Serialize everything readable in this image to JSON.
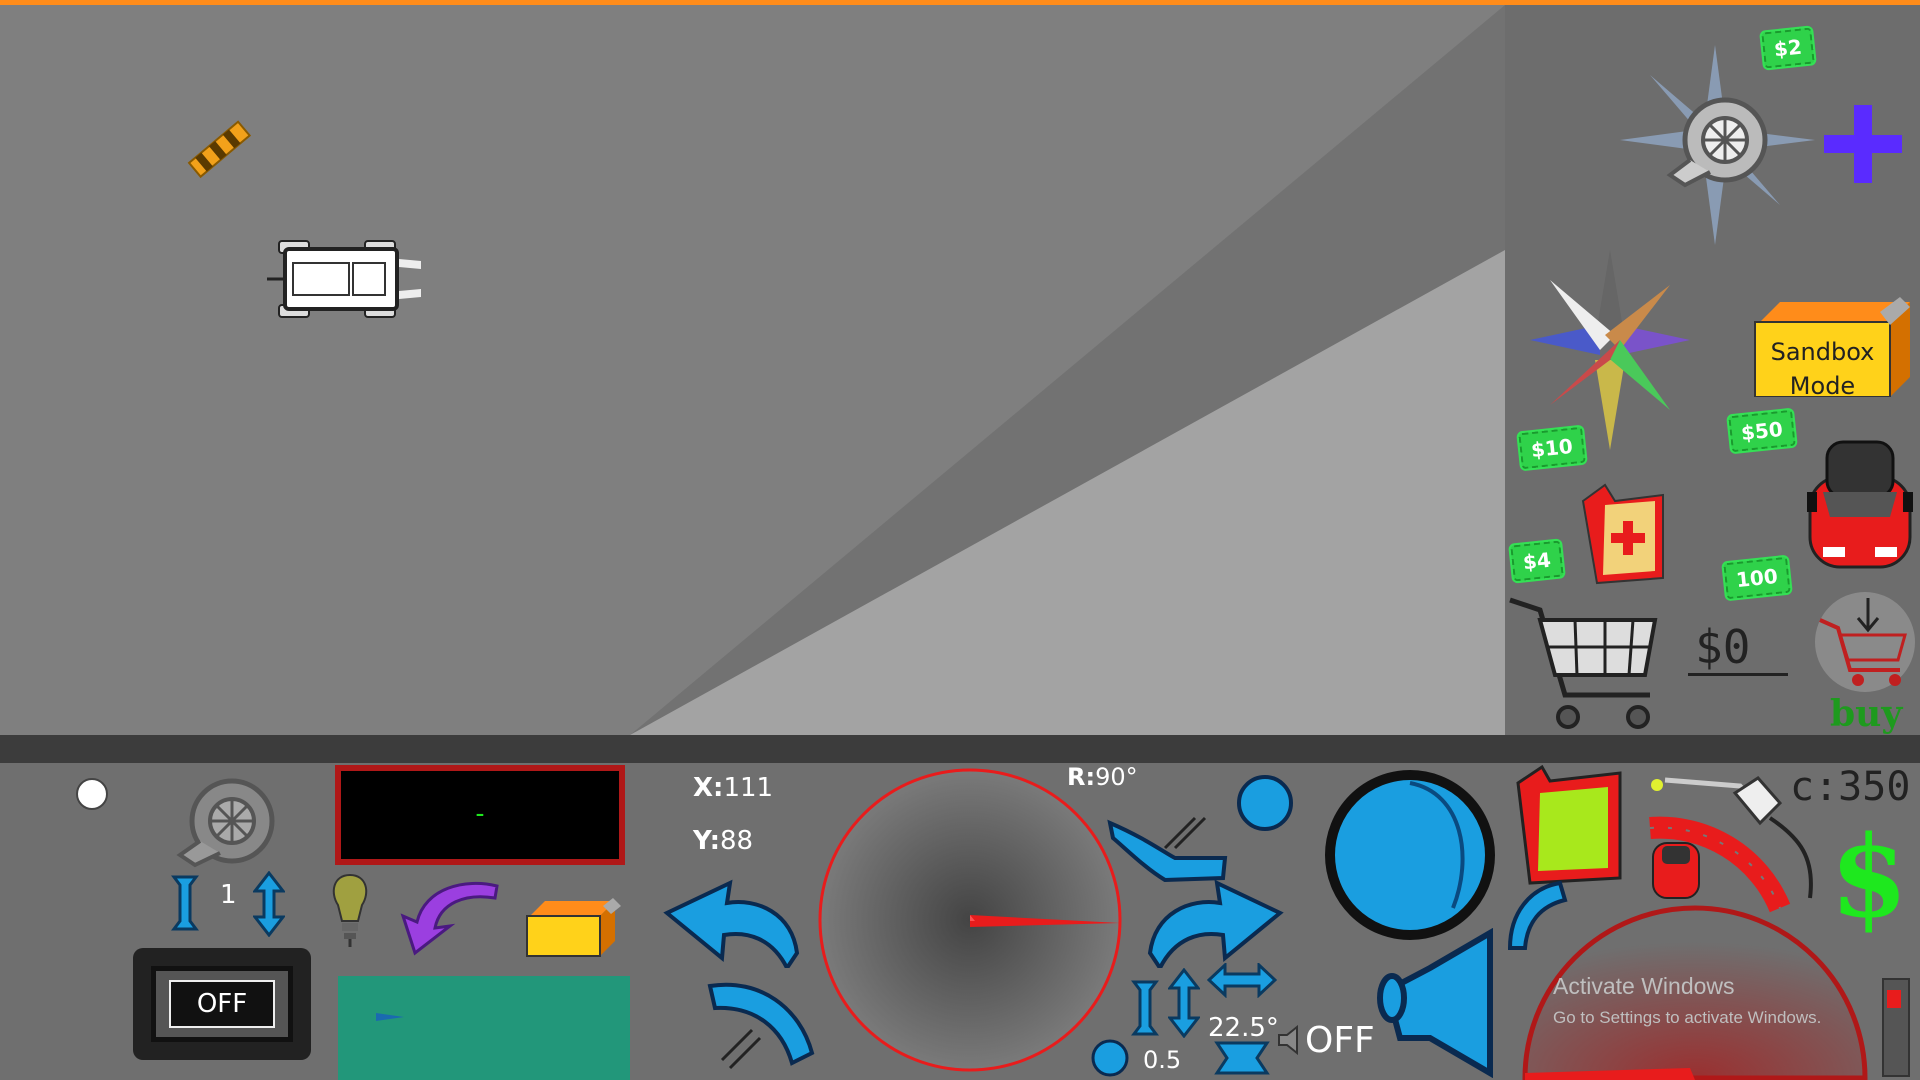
{
  "shop": {
    "price_turbo": "$2",
    "price_paint": "$10",
    "price_sandbox": "$50",
    "price_fuel": "$4",
    "price_car": "100",
    "sandbox_line1": "Sandbox",
    "sandbox_line2": "Mode",
    "money": "$0",
    "buy_label": "buy"
  },
  "hud": {
    "turbo_level": "1",
    "power_label": "OFF",
    "x_label": "X:",
    "x_value": "111",
    "y_label": "Y:",
    "y_value": "88",
    "rotation_label": "R:",
    "rotation_value": "90°",
    "step_value": "0.5",
    "angle_step": "22.5°",
    "horn_state": "OFF",
    "coins": "c:350",
    "display_text": "-"
  },
  "system": {
    "watermark_title": "Activate Windows",
    "watermark_sub": "Go to Settings to activate Windows."
  },
  "colors": {
    "accent_orange": "#ff8c1a",
    "hud_blue": "#1a9ee0",
    "money_green": "#2fd24a",
    "warning_red": "#e81c1c"
  }
}
